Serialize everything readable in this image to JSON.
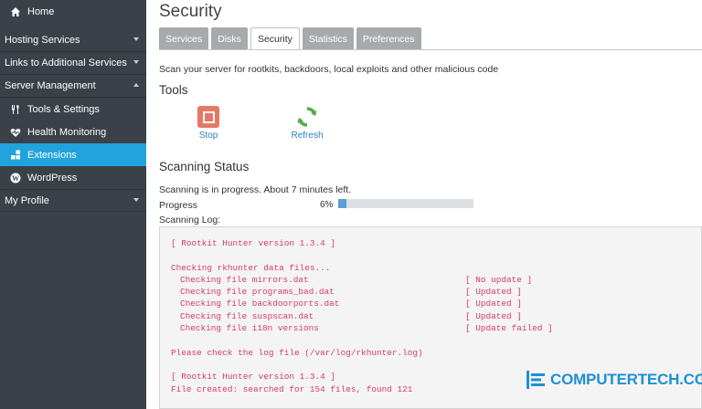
{
  "sidebar": {
    "home": "Home",
    "items": [
      {
        "label": "Hosting Services",
        "chevron": "down"
      },
      {
        "label": "Links to Additional Services",
        "chevron": "down"
      },
      {
        "label": "Server Management",
        "chevron": "up"
      }
    ],
    "sub_items": [
      {
        "label": "Tools & Settings",
        "icon": "tools-icon"
      },
      {
        "label": "Health Monitoring",
        "icon": "heart-pulse-icon"
      },
      {
        "label": "Extensions",
        "icon": "puzzle-icon",
        "active": true
      },
      {
        "label": "WordPress",
        "icon": "wordpress-icon"
      }
    ],
    "profile": "My Profile",
    "active_color": "#21a3dd"
  },
  "main": {
    "title": "Security",
    "tabs": [
      "Services",
      "Disks",
      "Security",
      "Statistics",
      "Preferences"
    ],
    "active_tab": "Security",
    "description": "Scan your server for rootkits, backdoors, local exploits and other malicious code",
    "tools_heading": "Tools",
    "tools": {
      "stop": "Stop",
      "refresh": "Refresh"
    },
    "scanning_heading": "Scanning Status",
    "status_text": "Scanning is in progress. About 7 minutes left.",
    "progress_label": "Progress",
    "progress_value": "6%",
    "progress_fraction": 0.06,
    "log_label": "Scanning Log:",
    "log": [
      {
        "text": "[ Rootkit Hunter version 1.3.4 ]",
        "status": ""
      },
      {
        "text": "",
        "status": ""
      },
      {
        "text": "Checking rkhunter data files...",
        "status": ""
      },
      {
        "text": "Checking file mirrors.dat",
        "status": "[ No update ]",
        "indent": true
      },
      {
        "text": "Checking file programs_bad.dat",
        "status": "[ Updated ]",
        "indent": true
      },
      {
        "text": "Checking file backdoorports.dat",
        "status": "[ Updated ]",
        "indent": true
      },
      {
        "text": "Checking file suspscan.dat",
        "status": "[ Updated ]",
        "indent": true
      },
      {
        "text": "Checking file i18n versions",
        "status": "[ Update failed ]",
        "indent": true
      },
      {
        "text": "",
        "status": ""
      },
      {
        "text": "Please check the log file (/var/log/rkhunter.log)",
        "status": ""
      },
      {
        "text": "",
        "status": ""
      },
      {
        "text": "[ Rootkit Hunter version 1.3.4 ]",
        "status": ""
      },
      {
        "text": "File created: searched for 154 files, found 121",
        "status": ""
      }
    ]
  },
  "watermark": {
    "text": "COMPUTERTECH.COM",
    "color": "#1e90d6"
  }
}
